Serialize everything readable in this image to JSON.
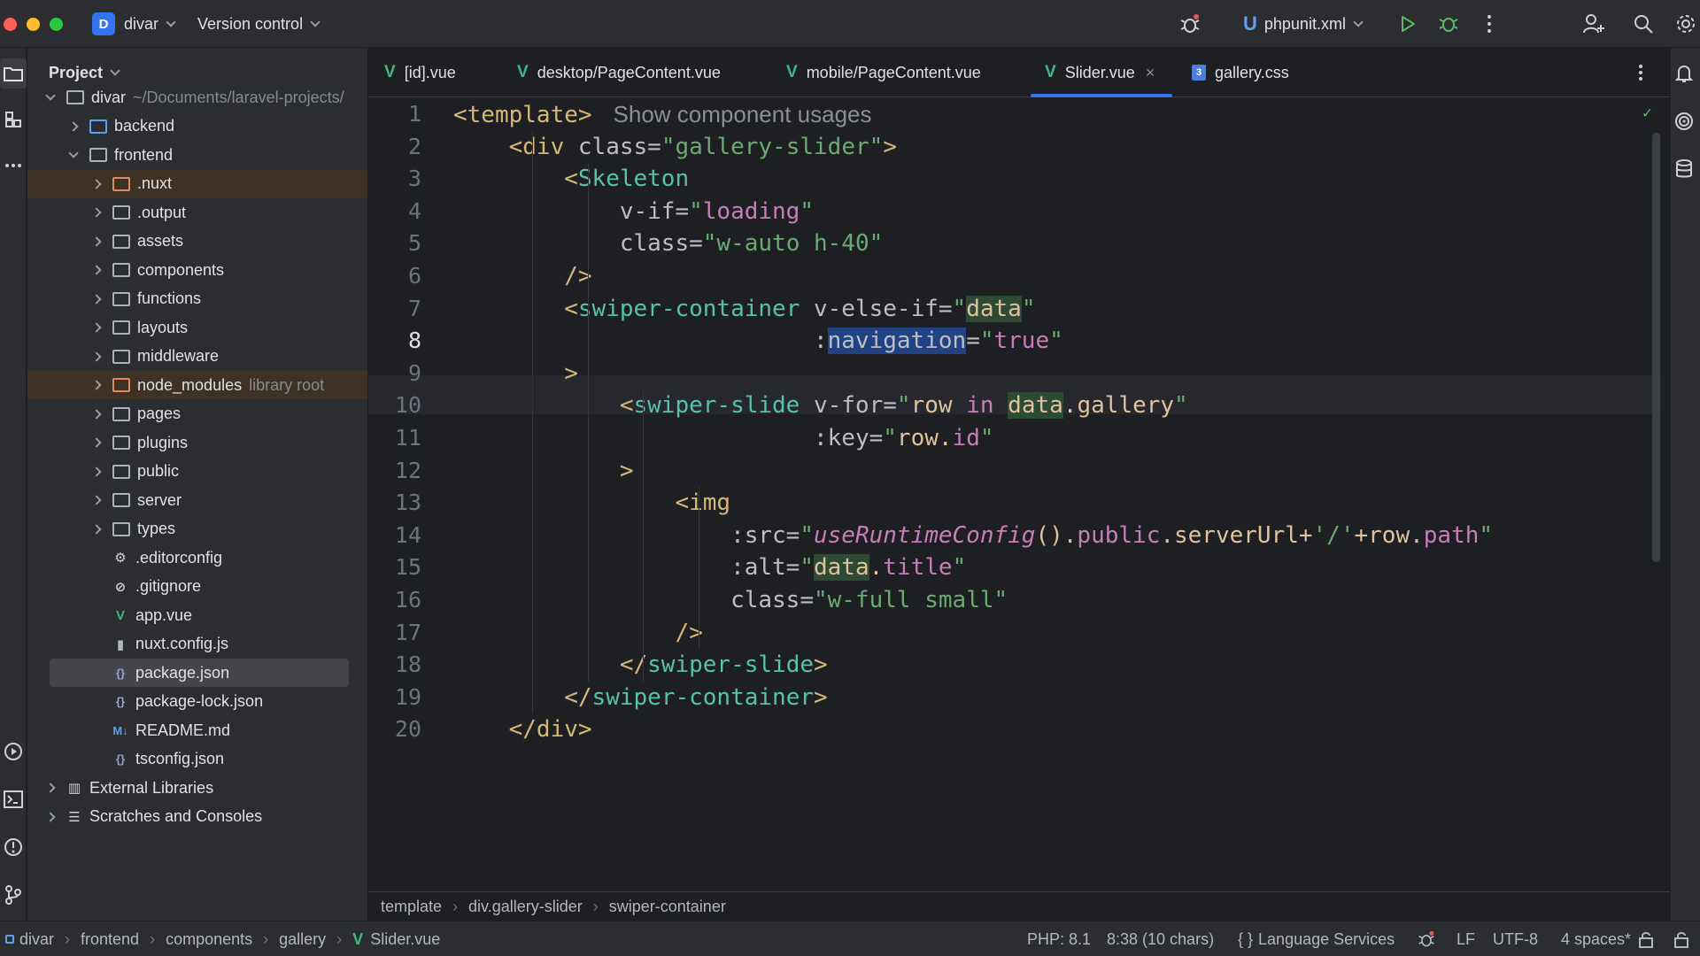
{
  "window": {
    "project_badge": "D",
    "project_name": "divar",
    "vcs_label": "Version control",
    "run_config": "phpunit.xml"
  },
  "project_panel": {
    "title": "Project",
    "tree": [
      {
        "label": "divar",
        "hint": "~/Documents/laravel-projects/",
        "kind": "folder",
        "expanded": true,
        "level": 0
      },
      {
        "label": "backend",
        "kind": "folder-blue",
        "expanded": false,
        "level": 1
      },
      {
        "label": "frontend",
        "kind": "folder",
        "expanded": true,
        "level": 1
      },
      {
        "label": ".nuxt",
        "kind": "folder-orange",
        "expanded": false,
        "level": 2,
        "excluded": true
      },
      {
        "label": ".output",
        "kind": "folder",
        "expanded": false,
        "level": 2
      },
      {
        "label": "assets",
        "kind": "folder",
        "expanded": false,
        "level": 2
      },
      {
        "label": "components",
        "kind": "folder",
        "expanded": false,
        "level": 2
      },
      {
        "label": "functions",
        "kind": "folder",
        "expanded": false,
        "level": 2
      },
      {
        "label": "layouts",
        "kind": "folder",
        "expanded": false,
        "level": 2
      },
      {
        "label": "middleware",
        "kind": "folder",
        "expanded": false,
        "level": 2
      },
      {
        "label": "node_modules",
        "hint": "library root",
        "kind": "folder-orange",
        "expanded": false,
        "level": 2,
        "excluded": true
      },
      {
        "label": "pages",
        "kind": "folder",
        "expanded": false,
        "level": 2
      },
      {
        "label": "plugins",
        "kind": "folder",
        "expanded": false,
        "level": 2
      },
      {
        "label": "public",
        "kind": "folder",
        "expanded": false,
        "level": 2
      },
      {
        "label": "server",
        "kind": "folder",
        "expanded": false,
        "level": 2
      },
      {
        "label": "types",
        "kind": "folder",
        "expanded": false,
        "level": 2
      },
      {
        "label": ".editorconfig",
        "kind": "gear-file",
        "level": 2
      },
      {
        "label": ".gitignore",
        "kind": "ignore-file",
        "level": 2
      },
      {
        "label": "app.vue",
        "kind": "vue-file",
        "level": 2
      },
      {
        "label": "nuxt.config.js",
        "kind": "js-file",
        "level": 2
      },
      {
        "label": "package.json",
        "kind": "json-file",
        "level": 2,
        "selected": true
      },
      {
        "label": "package-lock.json",
        "kind": "json-file",
        "level": 2
      },
      {
        "label": "README.md",
        "kind": "md-file",
        "level": 2
      },
      {
        "label": "tsconfig.json",
        "kind": "json-file",
        "level": 2
      },
      {
        "label": "External Libraries",
        "kind": "libraries",
        "expanded": false,
        "level": 0
      },
      {
        "label": "Scratches and Consoles",
        "kind": "scratches",
        "expanded": false,
        "level": 0
      }
    ]
  },
  "tabs": [
    {
      "label": "[id].vue",
      "icon": "vue-icon"
    },
    {
      "label": "desktop/PageContent.vue",
      "icon": "vue-icon"
    },
    {
      "label": "mobile/PageContent.vue",
      "icon": "vue-icon"
    },
    {
      "label": "Slider.vue",
      "icon": "vue-icon",
      "active": true,
      "close": "×"
    },
    {
      "label": "gallery.css",
      "icon": "css-icon"
    }
  ],
  "editor": {
    "inlay_hint": "Show component usages",
    "current_line": 8,
    "line_numbers": [
      "1",
      "2",
      "3",
      "4",
      "5",
      "6",
      "7",
      "8",
      "9",
      "10",
      "11",
      "12",
      "13",
      "14",
      "15",
      "16",
      "17",
      "18",
      "19",
      "20"
    ],
    "lines": [
      "<template>",
      "    <div class=\"gallery-slider\">",
      "        <Skeleton",
      "            v-if=\"loading\"",
      "            class=\"w-auto h-40\"",
      "        />",
      "        <swiper-container v-else-if=\"data\"",
      "                          :navigation=\"true\"",
      "        >",
      "            <swiper-slide v-for=\"row in data.gallery\"",
      "                          :key=\"row.id\"",
      "            >",
      "                <img",
      "                    :src=\"useRuntimeConfig().public.serverUrl+'/'+row.path\"",
      "                    :alt=\"data.title\"",
      "                    class=\"w-full small\"",
      "                />",
      "            </swiper-slide>",
      "        </swiper-container>",
      "    </div>"
    ]
  },
  "breadcrumb": [
    "template",
    "div.gallery-slider",
    "swiper-container"
  ],
  "status": {
    "path": [
      "divar",
      "frontend",
      "components",
      "gallery",
      "Slider.vue"
    ],
    "php": "PHP: 8.1",
    "position": "8:38 (10 chars)",
    "language_services": "Language Services",
    "line_sep": "LF",
    "encoding": "UTF-8",
    "indent": "4 spaces*"
  },
  "colors": {
    "accent": "#3574f0",
    "vue": "#41b883",
    "tag": "#d5b778",
    "component": "#56c2a8",
    "string": "#6aab73"
  }
}
